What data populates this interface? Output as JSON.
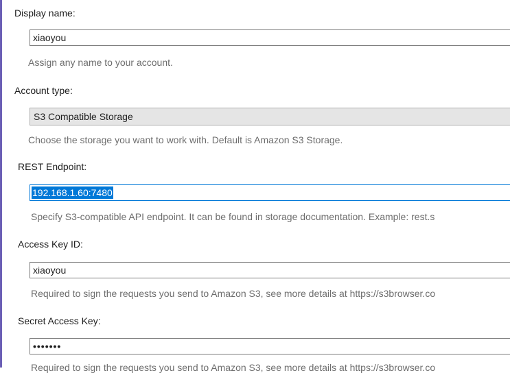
{
  "display_name": {
    "label": "Display name:",
    "value": "xiaoyou",
    "hint": "Assign any name to your account."
  },
  "account_type": {
    "label": "Account type:",
    "value": "S3 Compatible Storage",
    "hint": "Choose the storage you want to work with. Default is Amazon S3 Storage."
  },
  "rest_endpoint": {
    "label": "REST Endpoint:",
    "value": "192.168.1.60:7480",
    "hint": "Specify S3-compatible API endpoint. It can be found in storage documentation. Example: rest.s"
  },
  "access_key": {
    "label": "Access Key ID:",
    "value": "xiaoyou",
    "hint": "Required to sign the requests you send to Amazon S3, see more details at https://s3browser.co"
  },
  "secret_key": {
    "label": "Secret Access Key:",
    "value": "•••••••",
    "hint": "Required to sign the requests you send to Amazon S3, see more details at https://s3browser.co"
  },
  "colors": {
    "selection": "#0078d7",
    "hint_text": "#6d6d6d",
    "combo_bg": "#e5e5e5",
    "frame_accent": "#6b5fb5"
  }
}
